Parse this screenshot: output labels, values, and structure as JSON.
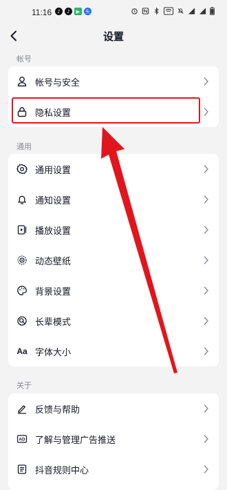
{
  "status_bar": {
    "time": "11:16",
    "app_icons": [
      "douyin-icon",
      "douyin-icon",
      "play-icon",
      "toutiao-icon"
    ],
    "system_icons": [
      "alarm-icon",
      "nfc-icon",
      "bluetooth-icon",
      "wifi-icon",
      "mute-icon",
      "signal-icon",
      "signal-icon",
      "battery-icon"
    ]
  },
  "nav": {
    "title": "设置"
  },
  "sections": [
    {
      "label": "帐号",
      "items": [
        {
          "label": "帐号与安全",
          "icon": "user-icon"
        },
        {
          "label": "隐私设置",
          "icon": "lock-icon"
        }
      ]
    },
    {
      "label": "通用",
      "items": [
        {
          "label": "通用设置",
          "icon": "gear-icon"
        },
        {
          "label": "通知设置",
          "icon": "bell-icon"
        },
        {
          "label": "播放设置",
          "icon": "play-setting-icon"
        },
        {
          "label": "动态壁纸",
          "icon": "wallpaper-icon"
        },
        {
          "label": "背景设置",
          "icon": "palette-icon"
        },
        {
          "label": "长辈模式",
          "icon": "elder-mode-icon"
        },
        {
          "label": "字体大小",
          "icon": "font-size-icon",
          "icon_text": "Aa"
        }
      ]
    },
    {
      "label": "关于",
      "items": [
        {
          "label": "反馈与帮助",
          "icon": "edit-icon"
        },
        {
          "label": "了解与管理广告推送",
          "icon": "ad-icon",
          "icon_text": "AD"
        },
        {
          "label": "抖音规则中心",
          "icon": "rules-icon"
        }
      ]
    }
  ],
  "annotation": {
    "highlight_color": "#e3151c",
    "highlighted_item": "隐私设置"
  },
  "colors": {
    "background": "#f3f3f4",
    "card": "#ffffff",
    "text": "#161823",
    "secondary_text": "#8a8b91",
    "annotation_red": "#e3151c"
  }
}
